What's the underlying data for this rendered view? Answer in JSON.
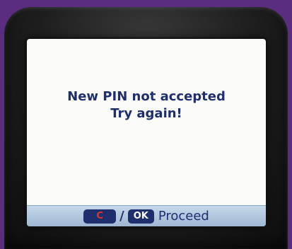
{
  "screen": {
    "message_line1": "New PIN not accepted",
    "message_line2": "Try again!"
  },
  "softkeys": {
    "cancel_key": "C",
    "separator": "/",
    "ok_key": "OK",
    "action_label": "Proceed"
  },
  "colors": {
    "frame_background": "#5a2d80",
    "screen_background": "#fbfbf9",
    "message_text": "#1f2f6e",
    "cancel_key_text": "#e0342b",
    "key_background": "#1f2f6e",
    "softkey_bar": "#b3c8df"
  }
}
